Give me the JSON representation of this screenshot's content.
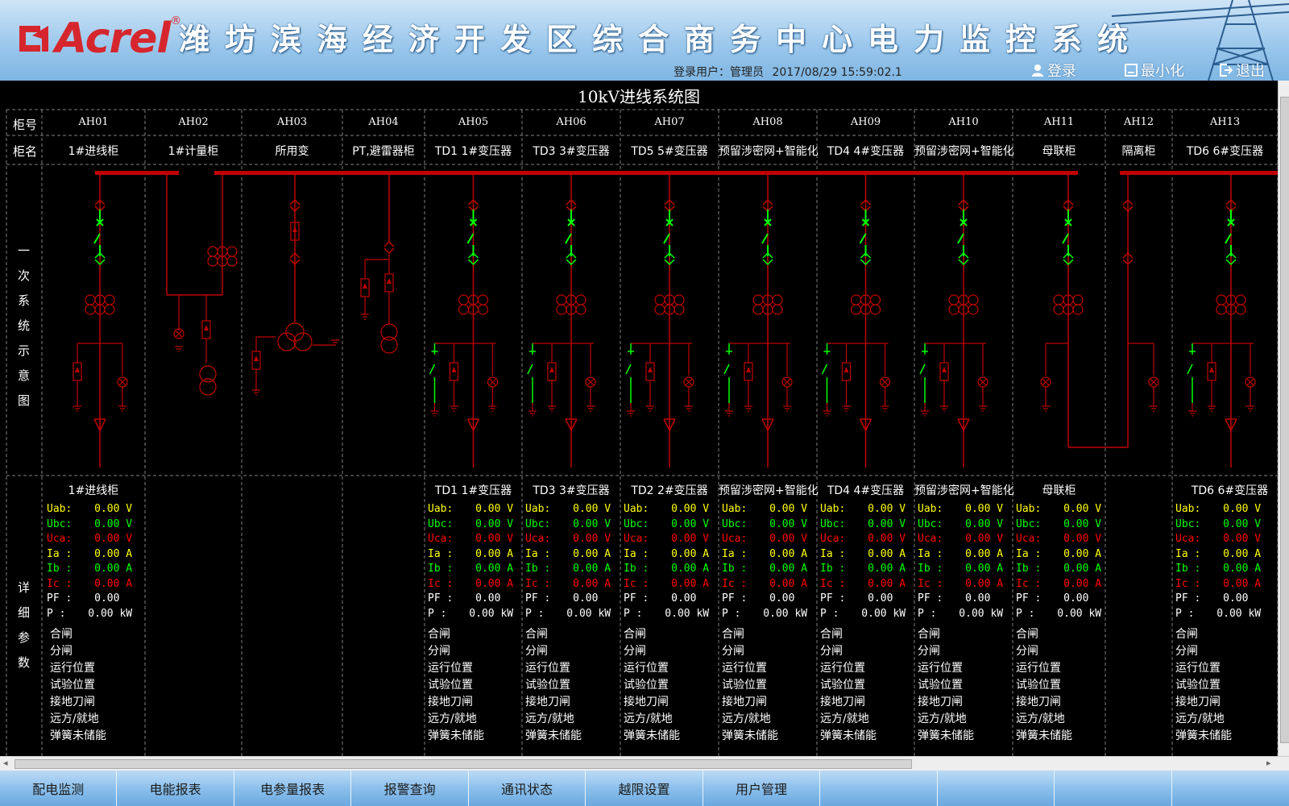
{
  "header": {
    "brand": "Acrel",
    "title": "潍坊滨海经济开发区综合商务中心电力监控系统",
    "user_label": "登录用户：管理员",
    "datetime": "2017/08/29 15:59:02.1",
    "buttons": {
      "login": "登录",
      "minimize": "最小化",
      "exit": "退出"
    }
  },
  "diagram": {
    "title": "10kV进线系统图",
    "row_labels": {
      "cabinet_no": "柜号",
      "cabinet_name": "柜名"
    },
    "side_labels": {
      "primary": [
        "一",
        "次",
        "系",
        "统",
        "示",
        "意",
        "图"
      ],
      "detail": [
        "详",
        "细",
        "参",
        "数"
      ]
    },
    "cabinets": [
      {
        "no": "AH01",
        "name": "1#进线柜",
        "type": "incoming",
        "detail": true,
        "ptitle": "1#进线柜"
      },
      {
        "no": "AH02",
        "name": "1#计量柜",
        "type": "metering",
        "detail": false,
        "ptitle": ""
      },
      {
        "no": "AH03",
        "name": "所用变",
        "type": "station",
        "detail": false,
        "ptitle": ""
      },
      {
        "no": "AH04",
        "name": "PT,避雷器柜",
        "type": "pt",
        "detail": false,
        "ptitle": ""
      },
      {
        "no": "AH05",
        "name": "TD1 1#变压器",
        "type": "feeder",
        "detail": true,
        "ptitle": "TD1 1#变压器"
      },
      {
        "no": "AH06",
        "name": "TD3 3#变压器",
        "type": "feeder",
        "detail": true,
        "ptitle": "TD3 3#变压器"
      },
      {
        "no": "AH07",
        "name": "TD5 5#变压器",
        "type": "feeder",
        "detail": true,
        "ptitle": "TD2 2#变压器"
      },
      {
        "no": "AH08",
        "name": "预留涉密网+智能化",
        "type": "feeder",
        "detail": true,
        "ptitle": "预留涉密网+智能化"
      },
      {
        "no": "AH09",
        "name": "TD4 4#变压器",
        "type": "feeder",
        "detail": true,
        "ptitle": "TD4 4#变压器"
      },
      {
        "no": "AH10",
        "name": "预留涉密网+智能化",
        "type": "feeder",
        "detail": true,
        "ptitle": "预留涉密网+智能化"
      },
      {
        "no": "AH11",
        "name": "母联柜",
        "type": "tie",
        "detail": true,
        "ptitle": "母联柜"
      },
      {
        "no": "AH12",
        "name": "隔离柜",
        "type": "isolation",
        "detail": false,
        "ptitle": ""
      },
      {
        "no": "AH13",
        "name": "TD6 6#变压器",
        "type": "feeder",
        "detail": true,
        "ptitle": "TD6 6#变压器"
      }
    ],
    "params": [
      {
        "label": "Uab:",
        "value": "0.00",
        "unit": "V",
        "color": "#ffff00"
      },
      {
        "label": "Ubc:",
        "value": "0.00",
        "unit": "V",
        "color": "#00ff00"
      },
      {
        "label": "Uca:",
        "value": "0.00",
        "unit": "V",
        "color": "#ff0000"
      },
      {
        "label": "Ia :",
        "value": "0.00",
        "unit": "A",
        "color": "#ffff00"
      },
      {
        "label": "Ib :",
        "value": "0.00",
        "unit": "A",
        "color": "#00ff00"
      },
      {
        "label": "Ic :",
        "value": "0.00",
        "unit": "A",
        "color": "#ff0000"
      },
      {
        "label": "PF :",
        "value": "0.00",
        "unit": "",
        "color": "#ffffff"
      },
      {
        "label": "P  :",
        "value": "0.00",
        "unit": "kW",
        "color": "#ffffff"
      }
    ],
    "statuses": [
      "合闸",
      "分闸",
      "运行位置",
      "试验位置",
      "接地刀闸",
      "远方/就地",
      "弹簧未储能"
    ]
  },
  "nav": {
    "tabs": [
      "配电监测",
      "电能报表",
      "电参量报表",
      "报警查询",
      "通讯状态",
      "越限设置",
      "用户管理",
      "",
      "",
      "",
      ""
    ]
  },
  "colors": {
    "bus": "#c00000",
    "breaker": "#00ff00",
    "grid": "#808080",
    "param_yellow": "#ffff00",
    "param_green": "#00ff00",
    "param_red": "#ff0000"
  }
}
